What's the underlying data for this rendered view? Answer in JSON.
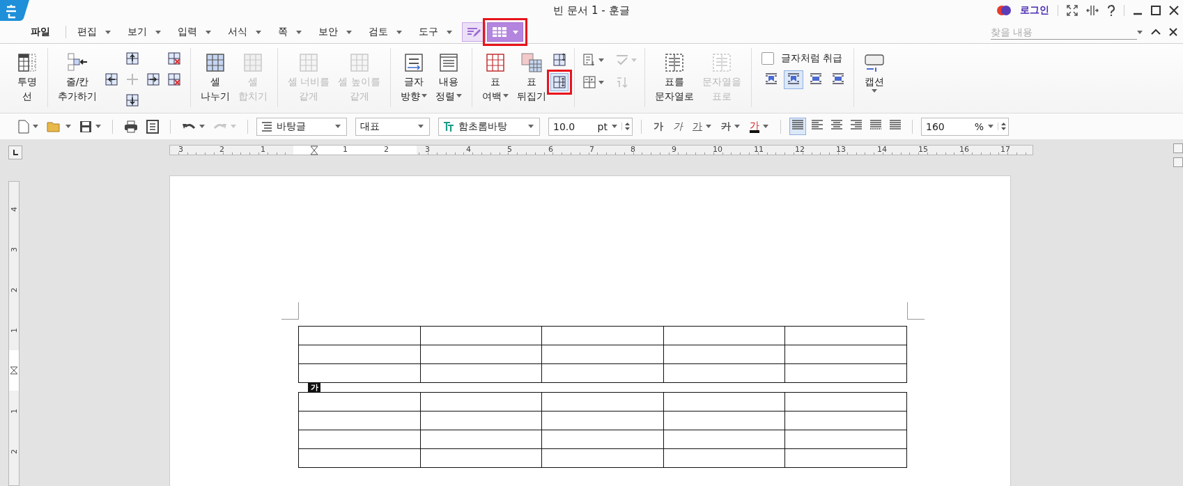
{
  "window": {
    "title": "빈 문서 1 - 훈글",
    "login": "로그인"
  },
  "menu": [
    {
      "kind": "text",
      "label": "파일",
      "dropdown": false,
      "selected": false
    },
    {
      "kind": "text",
      "label": "편집",
      "dropdown": true,
      "selected": false
    },
    {
      "kind": "text",
      "label": "보기",
      "dropdown": true,
      "selected": false
    },
    {
      "kind": "text",
      "label": "입력",
      "dropdown": true,
      "selected": false
    },
    {
      "kind": "text",
      "label": "서식",
      "dropdown": true,
      "selected": false
    },
    {
      "kind": "text",
      "label": "쪽",
      "dropdown": true,
      "selected": false
    },
    {
      "kind": "text",
      "label": "보안",
      "dropdown": true,
      "selected": false
    },
    {
      "kind": "text",
      "label": "검토",
      "dropdown": true,
      "selected": false
    },
    {
      "kind": "text",
      "label": "도구",
      "dropdown": true,
      "selected": false
    },
    {
      "kind": "draw",
      "dropdown": false,
      "selected": false
    },
    {
      "kind": "table",
      "dropdown": true,
      "selected": true
    }
  ],
  "search": {
    "placeholder": "찾을 내용"
  },
  "ribbon": {
    "large": [
      {
        "lines": [
          "투명",
          "선"
        ],
        "disabled": false,
        "dropdown": false
      },
      {
        "lines": [
          "줄/칸",
          "추가하기"
        ],
        "disabled": false,
        "dropdown": false
      },
      {
        "lines": [
          "셀",
          "나누기"
        ],
        "disabled": false,
        "dropdown": false
      },
      {
        "lines": [
          "셀",
          "합치기"
        ],
        "disabled": true,
        "dropdown": false
      },
      {
        "lines": [
          "셀 너비를",
          "같게"
        ],
        "disabled": true,
        "dropdown": false
      },
      {
        "lines": [
          "셀 높이를",
          "같게"
        ],
        "disabled": true,
        "dropdown": false
      },
      {
        "lines": [
          "글자",
          "방향"
        ],
        "disabled": false,
        "dropdown": true
      },
      {
        "lines": [
          "내용",
          "정렬"
        ],
        "disabled": false,
        "dropdown": true
      },
      {
        "lines": [
          "표",
          "여백"
        ],
        "disabled": false,
        "dropdown": true
      },
      {
        "lines": [
          "표",
          "뒤집기"
        ],
        "disabled": false,
        "dropdown": false
      },
      {
        "lines": [
          "표를",
          "문자열로"
        ],
        "disabled": false,
        "dropdown": false
      },
      {
        "lines": [
          "문자열을",
          "표로"
        ],
        "disabled": true,
        "dropdown": false
      },
      {
        "lines": [
          "캡션"
        ],
        "disabled": false,
        "dropdown": true
      }
    ],
    "rowcol_small": [
      {
        "disabled": false
      },
      {
        "disabled": false
      },
      {
        "disabled": true
      },
      {
        "disabled": false
      },
      {
        "disabled": false
      },
      {
        "disabled": false
      },
      {
        "disabled": false
      }
    ],
    "fit_small": [
      {
        "selected": false
      },
      {
        "selected": true
      }
    ],
    "calc_small": [
      {
        "disabled": false,
        "dropdown": true
      },
      {
        "disabled": true,
        "dropdown": true
      },
      {
        "disabled": false,
        "dropdown": true
      },
      {
        "disabled": true,
        "dropdown": false
      }
    ],
    "treat_as_char": {
      "label": "글자처럼 취급",
      "checked": false
    },
    "wrap": [
      {
        "selected": false
      },
      {
        "selected": true
      },
      {
        "selected": false
      },
      {
        "selected": false
      }
    ]
  },
  "toolbar": {
    "file_buttons": [
      {
        "dropdown": true,
        "disabled": false
      },
      {
        "dropdown": true,
        "disabled": false
      },
      {
        "dropdown": true,
        "disabled": false
      },
      {
        "dropdown": false,
        "disabled": false
      },
      {
        "dropdown": false,
        "disabled": false
      },
      {
        "dropdown": true,
        "disabled": false
      },
      {
        "dropdown": true,
        "disabled": true
      }
    ],
    "style": "바탕글",
    "outline": "대표",
    "font": "함초롬바탕",
    "size": "10.0",
    "size_unit": "pt",
    "char_buttons": [
      {
        "kind": "bold",
        "label": "가",
        "dropdown": false
      },
      {
        "kind": "italic",
        "label": "가",
        "dropdown": false
      },
      {
        "kind": "underline",
        "label": "가",
        "dropdown": true
      },
      {
        "kind": "strike",
        "label": "가",
        "dropdown": true
      },
      {
        "kind": "color",
        "label": "가",
        "dropdown": true
      }
    ],
    "align": [
      {
        "selected": true
      },
      {
        "selected": false
      },
      {
        "selected": false
      },
      {
        "selected": false
      },
      {
        "selected": false
      },
      {
        "selected": false
      }
    ],
    "zoom": "160",
    "zoom_unit": "%"
  },
  "ruler": {
    "left_labels": [
      "3",
      "2",
      "1"
    ],
    "right_labels": [
      "1",
      "2",
      "3",
      "4",
      "5",
      "6",
      "7",
      "8",
      "9",
      "10",
      "11",
      "12",
      "13",
      "14",
      "15",
      "16",
      "17"
    ],
    "upper_labels": [
      "4",
      "3",
      "2",
      "1"
    ],
    "lower_labels": [
      "1",
      "2"
    ]
  },
  "document": {
    "char_marker": "가"
  }
}
